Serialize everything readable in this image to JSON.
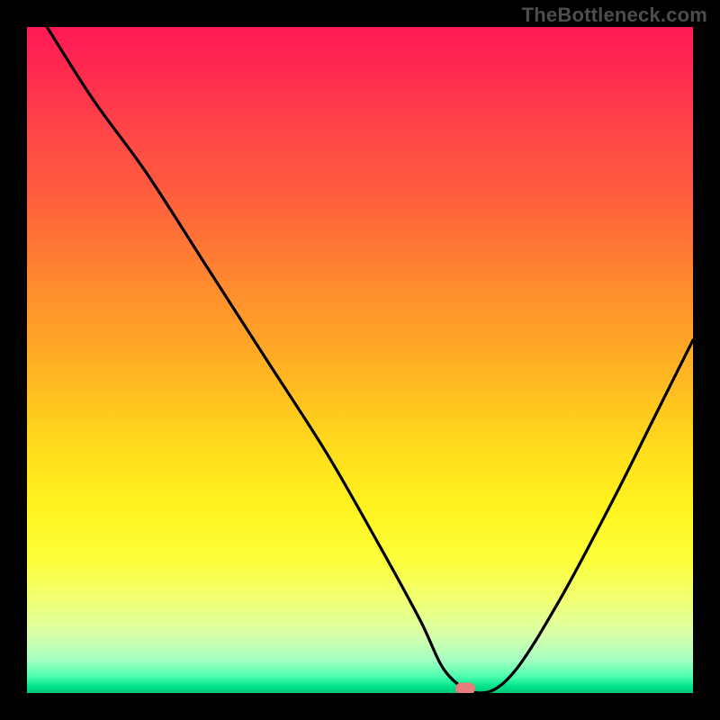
{
  "watermark": "TheBottleneck.com",
  "marker": {
    "x_pct": 65.8,
    "y_pct": 99.3,
    "color": "#e87c7c"
  },
  "chart_data": {
    "type": "line",
    "title": "",
    "xlabel": "",
    "ylabel": "",
    "xlim": [
      0,
      100
    ],
    "ylim": [
      0,
      100
    ],
    "grid": false,
    "legend": false,
    "series": [
      {
        "name": "bottleneck-curve",
        "x": [
          3,
          10,
          18,
          27,
          36,
          45,
          53,
          59,
          63,
          68,
          73,
          80,
          88,
          94,
          100
        ],
        "y": [
          100,
          89,
          78,
          64,
          50,
          36,
          22,
          11,
          3,
          0,
          3,
          14,
          29,
          41,
          53
        ]
      }
    ],
    "background": {
      "type": "vertical_gradient",
      "stops": [
        {
          "pct": 0,
          "color": "#ff1955"
        },
        {
          "pct": 16,
          "color": "#ff4747"
        },
        {
          "pct": 32,
          "color": "#ff7436"
        },
        {
          "pct": 48,
          "color": "#ffa726"
        },
        {
          "pct": 64,
          "color": "#ffde1c"
        },
        {
          "pct": 80,
          "color": "#fdff3a"
        },
        {
          "pct": 91,
          "color": "#d9ffa6"
        },
        {
          "pct": 97,
          "color": "#4dffb0"
        },
        {
          "pct": 100,
          "color": "#00c878"
        }
      ]
    },
    "marker_point": {
      "x": 65.8,
      "y": 0
    }
  }
}
